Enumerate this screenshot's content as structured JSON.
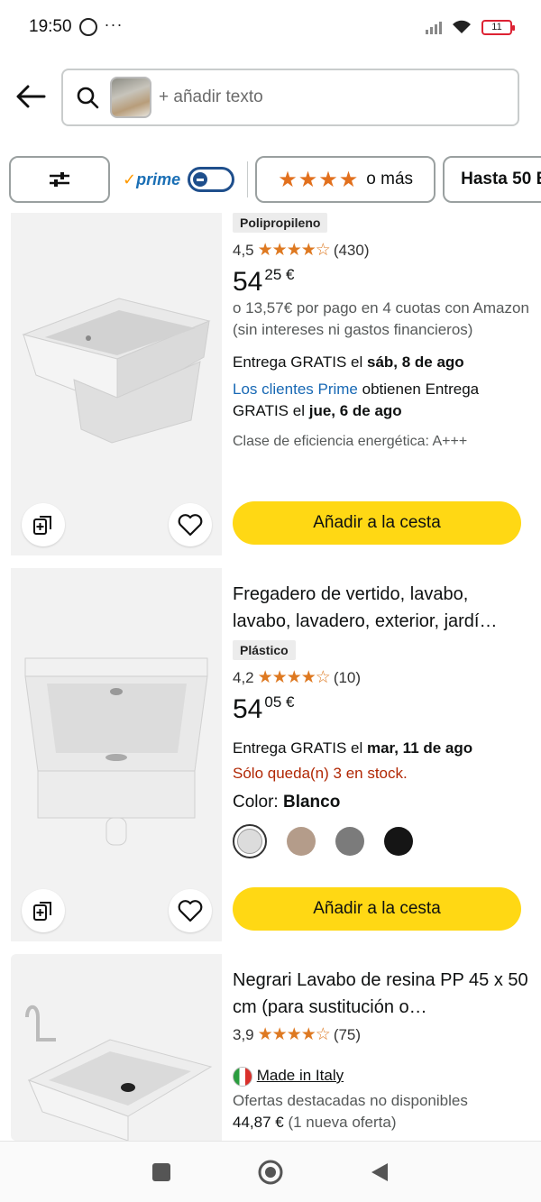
{
  "status": {
    "time": "19:50",
    "battery": "11"
  },
  "search": {
    "placeholder": "+ añadir texto"
  },
  "filters": {
    "prime": "prime",
    "stars_suffix": "o más",
    "price": "Hasta 50 E"
  },
  "products": [
    {
      "material_tag": "Polipropileno",
      "rating": "4,5",
      "stars": "★★★★☆",
      "reviews": "(430)",
      "price_whole": "54",
      "price_fraction": "25 €",
      "installments": "o 13,57€ por pago en 4 cuotas con Amazon (sin intereses ni gastos financieros)",
      "delivery_prefix": "Entrega GRATIS el",
      "delivery_date": "sáb, 8 de ago",
      "prime_link": "Los clientes Prime",
      "prime_text": "obtienen Entrega GRATIS el",
      "prime_date": "jue, 6 de ago",
      "energy": "Clase de eficiencia energética: A+++",
      "cart_button": "Añadir a la cesta"
    },
    {
      "title": "Fregadero de vertido, lavabo, lavabo, lavadero, exterior, jardí…",
      "material_tag": "Plástico",
      "rating": "4,2",
      "stars": "★★★★☆",
      "reviews": "(10)",
      "price_whole": "54",
      "price_fraction": "05 €",
      "delivery_prefix": "Entrega GRATIS el",
      "delivery_date": "mar, 11 de ago",
      "stock": "Sólo queda(n) 3 en stock.",
      "color_label": "Color:",
      "color_value": "Blanco",
      "swatch_colors": [
        "#dcdcdc",
        "#b49c8a",
        "#7b7b7b",
        "#151515"
      ],
      "cart_button": "Añadir a la cesta"
    },
    {
      "title": "Negrari Lavabo de resina PP 45 x 50 cm (para sustitución o…",
      "rating": "3,9",
      "stars": "★★★★☆",
      "reviews": "(75)",
      "origin": "Made in Italy",
      "offers_unavailable": "Ofertas destacadas no disponibles",
      "offer_price": "44,87 €",
      "offer_count": "(1 nueva oferta)"
    }
  ],
  "colors": {
    "accent_yellow": "#ffd814",
    "star_orange": "#de7921",
    "prime_blue": "#1768b4",
    "stock_red": "#b12704"
  }
}
